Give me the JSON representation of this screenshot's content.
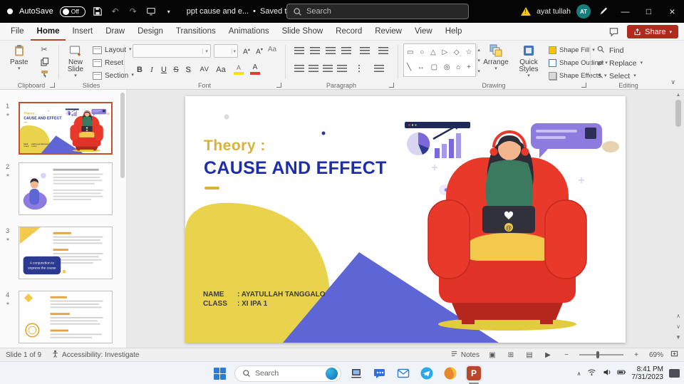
{
  "colors": {
    "accent_red": "#B7472A",
    "title_blue": "#1E2EA8",
    "title_gold": "#D8B33A",
    "blob_yellow": "#EAD34C",
    "triangle_indigo": "#5E66D6",
    "chair_red": "#E8392B",
    "avatar_teal": "#177E7B"
  },
  "title_bar": {
    "autosave_label": "AutoSave",
    "autosave_state": "Off",
    "doc_title": "ppt cause and e...",
    "separator": "•",
    "saved_status": "Saved to this PC",
    "search_placeholder": "Search",
    "user_name": "ayat tullah",
    "user_initials": "AT"
  },
  "menu": {
    "tabs": [
      "File",
      "Home",
      "Insert",
      "Draw",
      "Design",
      "Transitions",
      "Animations",
      "Slide Show",
      "Record",
      "Review",
      "View",
      "Help"
    ],
    "share_label": "Share"
  },
  "ribbon": {
    "clipboard": {
      "paste": "Paste",
      "label": "Clipboard"
    },
    "slides": {
      "new_slide": "New Slide",
      "layout": "Layout",
      "reset": "Reset",
      "section": "Section",
      "label": "Slides"
    },
    "font": {
      "label": "Font",
      "bold": "B",
      "italic": "I",
      "underline": "U",
      "strikethrough": "S",
      "shadow": "S",
      "spacing": "AV",
      "case": "Aa",
      "color_letter": "A"
    },
    "paragraph": {
      "label": "Paragraph"
    },
    "drawing": {
      "label": "Drawing",
      "arrange": "Arrange",
      "quick_styles": "Quick Styles",
      "shape_fill": "Shape Fill",
      "shape_outline": "Shape Outline",
      "shape_effects": "Shape Effects"
    },
    "editing": {
      "label": "Editing",
      "find": "Find",
      "replace": "Replace",
      "select": "Select"
    }
  },
  "slides_panel": {
    "numbers": [
      "1",
      "2",
      "3",
      "4"
    ],
    "callout_line1": "A conjunction to",
    "callout_line2": "express the cause"
  },
  "slide": {
    "pretitle": "Theory :",
    "title": "CAUSE AND EFFECT",
    "name_label": "NAME",
    "name_value": ": AYATULLAH TANGGALO",
    "class_label": "CLASS",
    "class_value": ": XI IPA 1"
  },
  "status_bar": {
    "slide_indicator": "Slide 1 of 9",
    "accessibility": "Accessibility: Investigate",
    "notes_label": "Notes",
    "zoom_level": "69%"
  },
  "taskbar": {
    "search_placeholder": "Search",
    "time": "8:41 PM",
    "date": "7/31/2023"
  },
  "icons": {
    "undo": "↶",
    "redo": "↷",
    "dropdown": "▾",
    "dropdown_up": "▴",
    "scissors": "✂",
    "minimize": "—",
    "maximize": "□",
    "close": "×",
    "warning": "!",
    "at_symbol": "@",
    "ppt_letter": "P",
    "tray_chevron": "∧",
    "shape_row1": "▭ ○ △ ▷ ◇ ☆",
    "shape_row2": "╲ ↔ ▢ ◎ ⌂ +",
    "scroll_up": "▲",
    "scroll_down": "▼",
    "prev": "∧",
    "next": "∨",
    "view_normal": "▣",
    "view_sorter": "⊞",
    "view_reading": "▤",
    "view_slideshow": "▶",
    "zoom_out": "−",
    "zoom_in": "+",
    "replace_glyph": "⇄",
    "select_glyph": "↖",
    "star": "★"
  }
}
